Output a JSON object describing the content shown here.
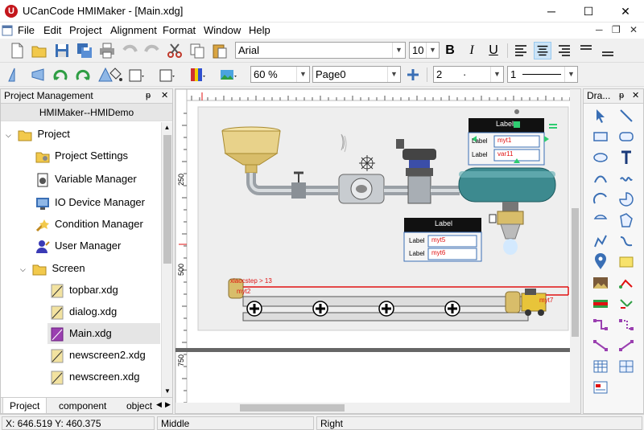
{
  "window": {
    "title": "UCanCode HMIMaker - [Main.xdg]",
    "app_icon_letter": "U",
    "minimize": "─",
    "maximize": "☐",
    "close": "✕"
  },
  "menu": {
    "items": [
      "File",
      "Edit",
      "Project",
      "Alignment",
      "Format",
      "Window",
      "Help"
    ],
    "mdi_minimize": "─",
    "mdi_restore": "❐",
    "mdi_close": "✕"
  },
  "format_toolbar": {
    "font_name": "Arial",
    "font_size": "10",
    "bold": "B",
    "italic": "I",
    "underline": "U"
  },
  "view_toolbar": {
    "zoom": "60 %",
    "page": "Page0",
    "line_width": "2",
    "line_style_dot": "·",
    "line_pattern": "1"
  },
  "project_panel": {
    "title": "Project Management",
    "pin": "ᵽ",
    "close": "✕",
    "caption": "HMIMaker--HMIDemo",
    "tree": {
      "root": "Project",
      "settings": "Project Settings",
      "variables": "Variable Manager",
      "io": "IO Device Manager",
      "condition": "Condition Manager",
      "users": "User Manager",
      "screen": "Screen",
      "screens": [
        "topbar.xdg",
        "dialog.xdg",
        "Main.xdg",
        "newscreen2.xdg",
        "newscreen.xdg"
      ]
    },
    "tabs": [
      "Project",
      "component",
      "object"
    ]
  },
  "canvas": {
    "ruler_labels": [
      "250",
      "500",
      "750"
    ],
    "panel1": {
      "title": "Label",
      "row1_label": "Label",
      "row1_value": "myt1",
      "row2_label": "Label",
      "row2_value": "var11"
    },
    "panel2": {
      "title": "Label",
      "row1_label": "Label",
      "row1_value": "myt5",
      "row2_label": "Label",
      "row2_value": "myt6"
    },
    "conveyor_text1": "xiaocstep > 13",
    "conveyor_text2": "myt2",
    "forklift_text": "myt7"
  },
  "draw_panel": {
    "title": "Dra...",
    "pin": "ᵽ",
    "close": "✕"
  },
  "status": {
    "coords": "X: 646.519 Y: 460.375",
    "middle": "Middle",
    "right": "Right"
  },
  "colors": {
    "accent": "#0078d7",
    "tank": "#3d8a8f",
    "pipe": "#b0b4b8",
    "hopper": "#e8d28a",
    "red_line": "#e01010"
  }
}
